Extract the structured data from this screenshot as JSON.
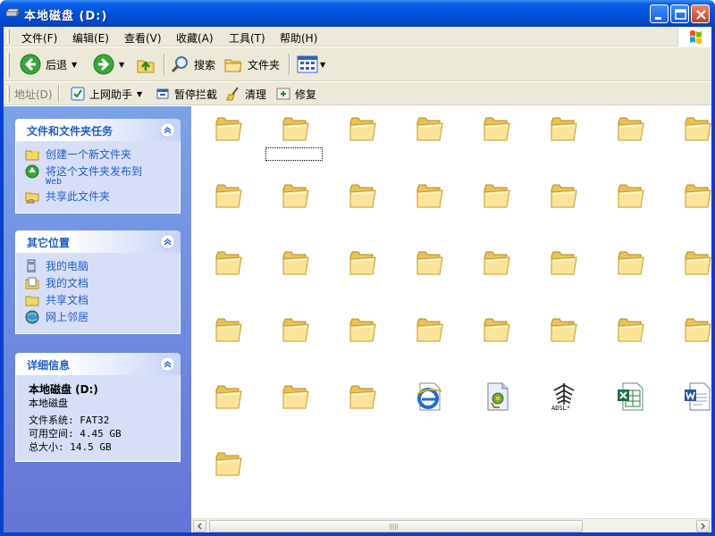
{
  "window": {
    "title": "本地磁盘 (D:)",
    "minimize_icon": "minimize-icon",
    "maximize_icon": "maximize-icon",
    "close_icon": "close-icon",
    "title_bar_color": "#0052df"
  },
  "menu": {
    "items": [
      "文件(F)",
      "编辑(E)",
      "查看(V)",
      "收藏(A)",
      "工具(T)",
      "帮助(H)"
    ]
  },
  "toolbar": {
    "back_label": "后退",
    "search_label": "搜索",
    "folders_label": "文件夹"
  },
  "addressbar": {
    "label": "地址(D)",
    "links": [
      "上网助手",
      "暂停拦截",
      "清理",
      "修复"
    ]
  },
  "taskpane": {
    "file_tasks": {
      "title": "文件和文件夹任务",
      "items": [
        {
          "label": "创建一个新文件夹",
          "sub": ""
        },
        {
          "label": "将这个文件夹发布到",
          "sub": "Web"
        },
        {
          "label": "共享此文件夹",
          "sub": ""
        }
      ]
    },
    "other_places": {
      "title": "其它位置",
      "items": [
        "我的电脑",
        "我的文档",
        "共享文档",
        "网上邻居"
      ]
    },
    "details": {
      "title": "详细信息",
      "name": "本地磁盘 (D:)",
      "type": "本地磁盘",
      "filesystem": "文件系统: FAT32",
      "free_space": "可用空间: 4.45 GB",
      "total_size": "总大小: 14.5 GB"
    }
  },
  "content": {
    "view": "icons",
    "items": [
      {
        "kind": "folder-icon"
      },
      {
        "kind": "folder-icon"
      },
      {
        "kind": "folder-icon"
      },
      {
        "kind": "folder-icon"
      },
      {
        "kind": "folder-icon"
      },
      {
        "kind": "folder-icon"
      },
      {
        "kind": "folder-icon"
      },
      {
        "kind": "folder-icon"
      },
      {
        "kind": "folder-icon"
      },
      {
        "kind": "folder-icon"
      },
      {
        "kind": "folder-icon"
      },
      {
        "kind": "folder-icon"
      },
      {
        "kind": "folder-icon"
      },
      {
        "kind": "folder-icon"
      },
      {
        "kind": "folder-icon"
      },
      {
        "kind": "folder-icon"
      },
      {
        "kind": "folder-icon"
      },
      {
        "kind": "folder-icon"
      },
      {
        "kind": "folder-icon"
      },
      {
        "kind": "folder-icon"
      },
      {
        "kind": "folder-icon"
      },
      {
        "kind": "folder-icon"
      },
      {
        "kind": "folder-icon"
      },
      {
        "kind": "folder-icon"
      },
      {
        "kind": "folder-icon"
      },
      {
        "kind": "folder-icon"
      },
      {
        "kind": "folder-icon"
      },
      {
        "kind": "folder-icon"
      },
      {
        "kind": "folder-icon"
      },
      {
        "kind": "folder-icon"
      },
      {
        "kind": "folder-icon"
      },
      {
        "kind": "folder-icon"
      },
      {
        "kind": "folder-icon"
      },
      {
        "kind": "folder-icon"
      },
      {
        "kind": "folder-icon"
      },
      {
        "kind": "ie-html-file-icon"
      },
      {
        "kind": "setup-file-icon"
      },
      {
        "kind": "adsl-file-icon",
        "label": "ADSL"
      },
      {
        "kind": "excel-file-icon"
      },
      {
        "kind": "word-file-icon"
      },
      {
        "kind": "folder-icon"
      }
    ]
  },
  "colors": {
    "task_pane_top": "#7ba2e7",
    "task_pane_bottom": "#6375d6",
    "panel_body": "#d6dff7",
    "link_blue": "#215dc6",
    "chrome": "#ece9d8"
  }
}
